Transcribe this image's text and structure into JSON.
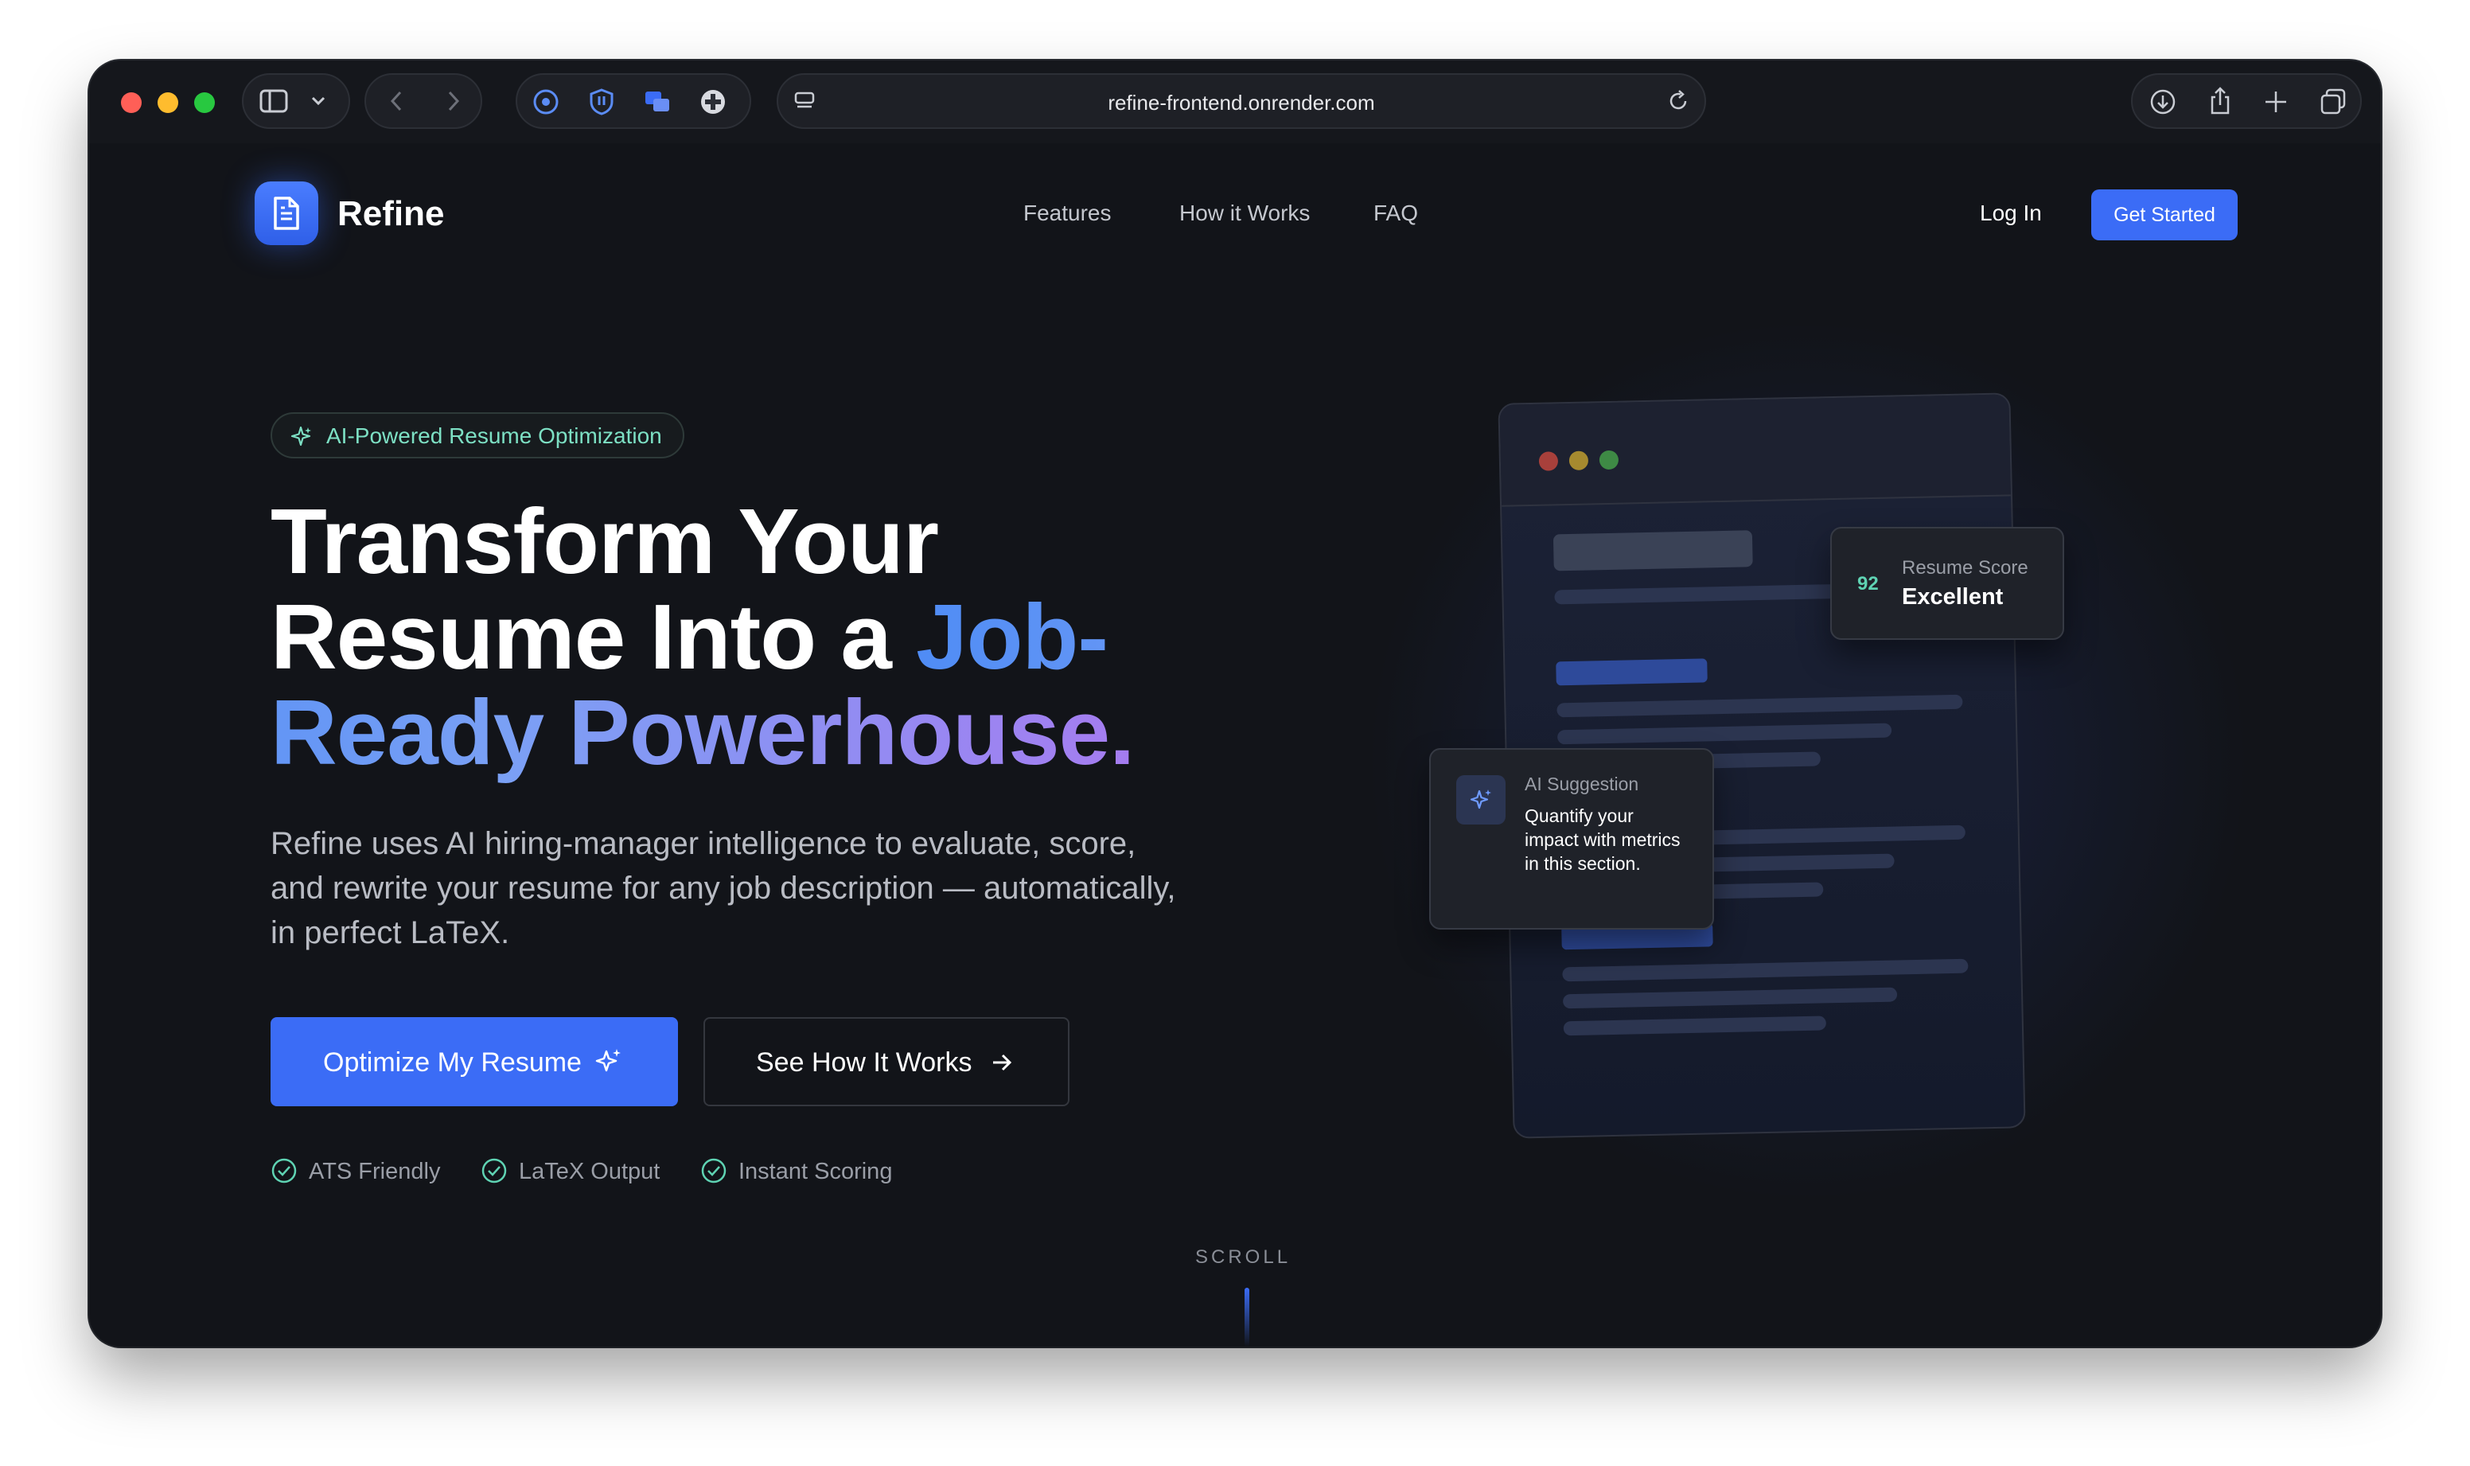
{
  "browser": {
    "url": "refine-frontend.onrender.com"
  },
  "nav": {
    "brand": "Refine",
    "links": [
      "Features",
      "How it Works",
      "FAQ"
    ],
    "login": "Log In",
    "cta": "Get Started"
  },
  "hero": {
    "badge": "AI-Powered Resume Optimization",
    "title_plain": "Transform Your Resume Into a",
    "title_highlight": "Job-Ready Powerhouse.",
    "subtitle": "Refine uses AI hiring-manager intelligence to evaluate, score, and rewrite your resume for any job description — automatically, in perfect LaTeX.",
    "primary_button": "Optimize My Resume",
    "secondary_button": "See How It Works",
    "features": [
      "ATS Friendly",
      "LaTeX Output",
      "Instant Scoring"
    ],
    "scroll_label": "SCROLL"
  },
  "illustration": {
    "score_value": "92",
    "score_label": "Resume Score",
    "score_rating": "Excellent",
    "suggestion_title": "AI Suggestion",
    "suggestion_text": "Quantify your impact with metrics in this section."
  },
  "colors": {
    "accent": "#3b6cf6",
    "teal": "#7de0c4",
    "background": "#121419"
  }
}
